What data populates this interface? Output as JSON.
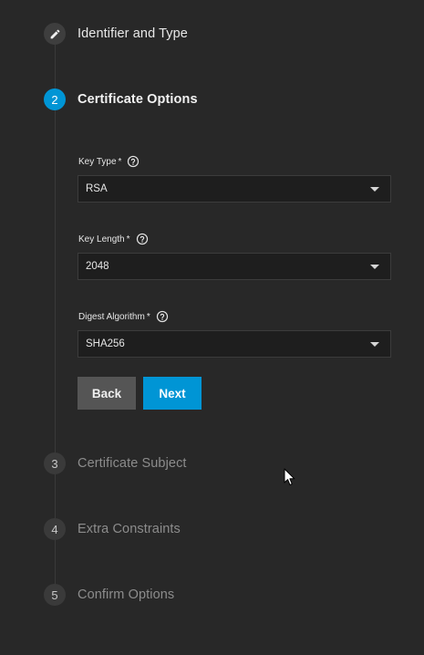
{
  "stepper": {
    "steps": [
      {
        "number": "",
        "label": "Identifier and Type",
        "state": "done",
        "icon": "pencil-icon"
      },
      {
        "number": "2",
        "label": "Certificate Options",
        "state": "active"
      },
      {
        "number": "3",
        "label": "Certificate Subject",
        "state": "pending"
      },
      {
        "number": "4",
        "label": "Extra Constraints",
        "state": "pending"
      },
      {
        "number": "5",
        "label": "Confirm Options",
        "state": "pending"
      }
    ]
  },
  "form": {
    "key_type": {
      "label": "Key Type",
      "required": "*",
      "value": "RSA",
      "help_icon": "help-circle-icon"
    },
    "key_length": {
      "label": "Key Length",
      "required": "*",
      "value": "2048",
      "help_icon": "help-circle-icon"
    },
    "digest_algorithm": {
      "label": "Digest Algorithm",
      "required": "*",
      "value": "SHA256",
      "help_icon": "help-circle-icon"
    }
  },
  "actions": {
    "back_label": "Back",
    "next_label": "Next"
  },
  "colors": {
    "background": "#282828",
    "accent": "#0095d5",
    "field_bg": "#1e1e1e",
    "back_button": "#555555"
  }
}
